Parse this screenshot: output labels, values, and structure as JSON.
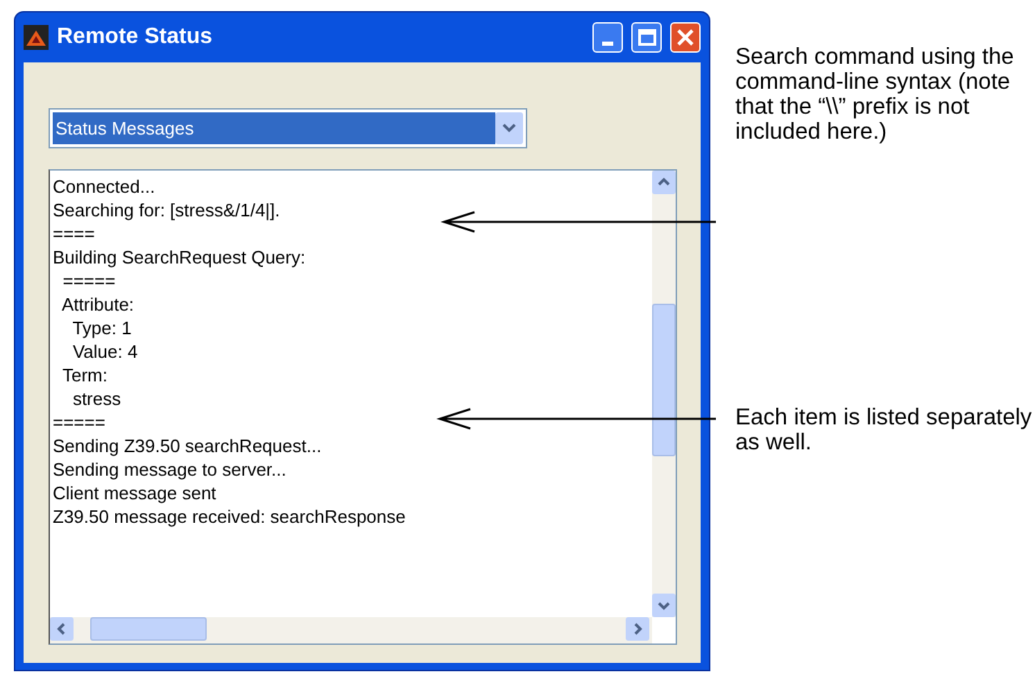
{
  "window": {
    "title": "Remote Status"
  },
  "dropdown": {
    "value": "Status Messages"
  },
  "log": {
    "lines": [
      "Connected...",
      "Searching for: [stress&/1/4|].",
      "====",
      "Building SearchRequest Query:",
      "  =====",
      "  Attribute:",
      "    Type: 1",
      "    Value: 4",
      "  Term:",
      "    stress",
      "=====",
      "Sending Z39.50 searchRequest...",
      "Sending message to server...",
      "Client message sent",
      "Z39.50 message received: searchResponse"
    ]
  },
  "annotations": [
    {
      "text": "Search command using the command-line syntax (note that the “\\\\” prefix is not included here.)"
    },
    {
      "text": "Each item is listed separately as well."
    }
  ]
}
